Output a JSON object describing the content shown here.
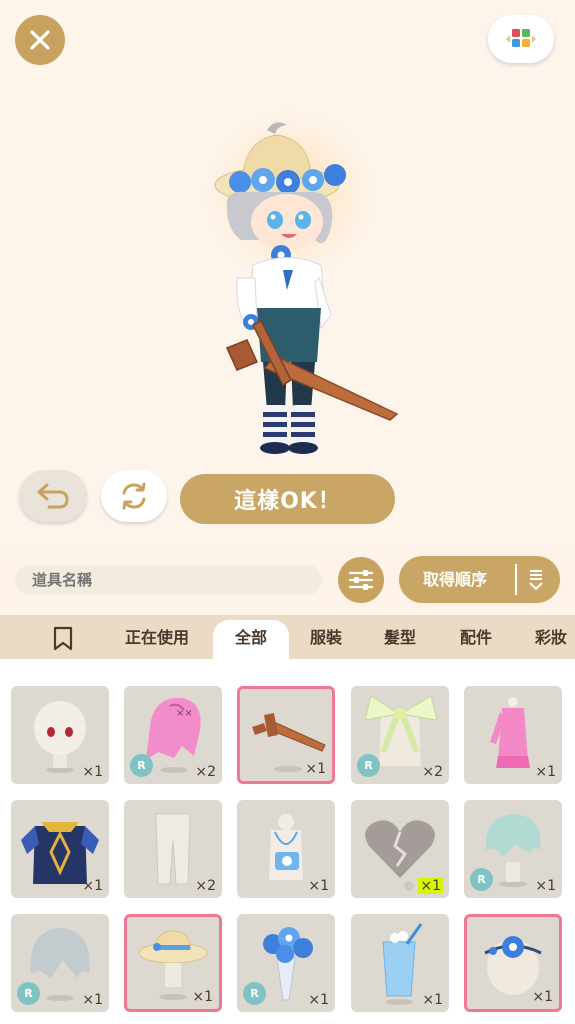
{
  "header": {
    "close_icon": "close-icon",
    "palette_icon": "color-palette-icon"
  },
  "actions": {
    "undo_icon": "undo-icon",
    "rotate_icon": "rotate-icon",
    "ok_label": "這樣OK！"
  },
  "search": {
    "placeholder": "道具名稱"
  },
  "sort": {
    "label": "取得順序"
  },
  "tabs": [
    {
      "label": "正在使用"
    },
    {
      "label": "全部"
    },
    {
      "label": "服裝"
    },
    {
      "label": "髮型"
    },
    {
      "label": "配件"
    },
    {
      "label": "彩妝"
    }
  ],
  "items": [
    {
      "name": "face",
      "qty": "×1",
      "badge": ""
    },
    {
      "name": "pink-hair",
      "qty": "×2",
      "badge": "R"
    },
    {
      "name": "wooden-sword",
      "qty": "×1",
      "badge": ""
    },
    {
      "name": "green-bow",
      "qty": "×2",
      "badge": "R"
    },
    {
      "name": "pink-dress",
      "qty": "×1",
      "badge": ""
    },
    {
      "name": "blue-robe",
      "qty": "×1",
      "badge": ""
    },
    {
      "name": "white-pants",
      "qty": "×2",
      "badge": ""
    },
    {
      "name": "camera-necklace",
      "qty": "×1",
      "badge": ""
    },
    {
      "name": "broken-heart",
      "qty": "×1",
      "badge": ""
    },
    {
      "name": "mint-hair",
      "qty": "×1",
      "badge": "R"
    },
    {
      "name": "gray-hair",
      "qty": "×1",
      "badge": "R"
    },
    {
      "name": "straw-hat",
      "qty": "×1",
      "badge": ""
    },
    {
      "name": "flower-bouquet",
      "qty": "×1",
      "badge": "R"
    },
    {
      "name": "blue-drink",
      "qty": "×1",
      "badge": ""
    },
    {
      "name": "flower-headband",
      "qty": "×1",
      "badge": ""
    }
  ],
  "colors": {
    "gold": "#c9a665",
    "selected_border": "#ef7896",
    "badge": "#7fc3c4",
    "tab_bar": "#ecdbc4"
  }
}
